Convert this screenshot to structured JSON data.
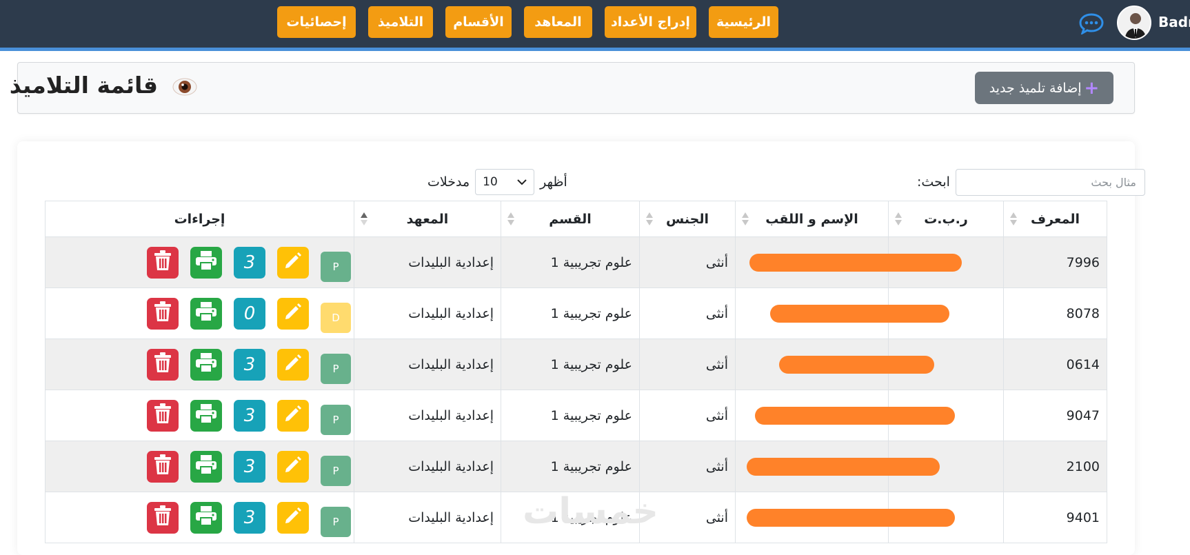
{
  "navbar": {
    "items": [
      {
        "label": "الرئيسية"
      },
      {
        "label": "إدراج الأعداد"
      },
      {
        "label": "المعاهد"
      },
      {
        "label": "الأقسام"
      },
      {
        "label": "التلاميذ"
      },
      {
        "label": "إحصائيات"
      }
    ],
    "user_name": "Badr",
    "chat_icon": "chat-bubble-icon"
  },
  "header": {
    "title": "قائمة التلاميذ",
    "title_icon": "eye-icon",
    "add_button": "إضافة تلميذ جديد"
  },
  "table_controls": {
    "show_label": "أظهر",
    "page_length": "10",
    "entries_label": "مدخلات",
    "search_label": ":ابحث",
    "search_placeholder": "مثال بحث"
  },
  "table": {
    "columns": [
      "المعرف",
      "ر.ب.ت",
      "الإسم و اللقب",
      "الجنس",
      "القسم",
      "المعهد",
      "إجراءات"
    ],
    "rows": [
      {
        "id": "7996",
        "gender": "أنثى",
        "class": "علوم تجريبية 1",
        "school": "إعدادية البليدات",
        "count": "3",
        "status": "P"
      },
      {
        "id": "8078",
        "gender": "أنثى",
        "class": "علوم تجريبية 1",
        "school": "إعدادية البليدات",
        "count": "0",
        "status": "D"
      },
      {
        "id": "0614",
        "gender": "أنثى",
        "class": "علوم تجريبية 1",
        "school": "إعدادية البليدات",
        "count": "3",
        "status": "P"
      },
      {
        "id": "9047",
        "gender": "أنثى",
        "class": "علوم تجريبية 1",
        "school": "إعدادية البليدات",
        "count": "3",
        "status": "P"
      },
      {
        "id": "2100",
        "gender": "أنثى",
        "class": "علوم تجريبية 1",
        "school": "إعدادية البليدات",
        "count": "3",
        "status": "P"
      },
      {
        "id": "9401",
        "gender": "أنثى",
        "class": "علوم تجريبية 1",
        "school": "إعدادية البليدات",
        "count": "3",
        "status": "P"
      }
    ]
  },
  "colors": {
    "navbar": "#2d3b4c",
    "nav_button": "#f39c12",
    "delete": "#dc3545",
    "print": "#28a745",
    "count": "#17a2b8",
    "edit": "#ffc107",
    "status_p": "#68b18c",
    "status_d": "#ffdb6e",
    "redaction": "#ff8229"
  },
  "watermark": "خمسات"
}
